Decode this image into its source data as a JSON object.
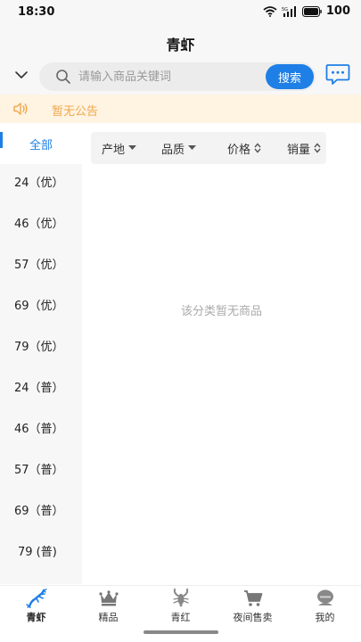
{
  "status": {
    "time": "18:30",
    "battery": "100",
    "network": "5G"
  },
  "nav": {
    "title": "青虾"
  },
  "search": {
    "placeholder": "请输入商品关键词",
    "button_label": "搜索"
  },
  "notice": {
    "text": "暂无公告"
  },
  "sidebar": {
    "items": [
      {
        "label": "全部",
        "active": true
      },
      {
        "label": "24（优）"
      },
      {
        "label": "46（优）"
      },
      {
        "label": "57（优）"
      },
      {
        "label": "69（优）"
      },
      {
        "label": "79（优）"
      },
      {
        "label": "24（普）"
      },
      {
        "label": "46（普）"
      },
      {
        "label": "57（普）"
      },
      {
        "label": "69（普）"
      },
      {
        "label": "79 (普)"
      }
    ]
  },
  "filters": [
    {
      "label": "产地",
      "icon": "caret-down-icon"
    },
    {
      "label": "品质",
      "icon": "caret-down-icon"
    },
    {
      "label": "价格",
      "icon": "sort-icon"
    },
    {
      "label": "销量",
      "icon": "sort-icon"
    }
  ],
  "empty_text": "该分类暂无商品",
  "tabbar": {
    "items": [
      {
        "label": "青虾",
        "icon": "lobster-icon",
        "active": true
      },
      {
        "label": "精品",
        "icon": "crown-icon"
      },
      {
        "label": "青红",
        "icon": "crayfish-icon"
      },
      {
        "label": "夜间售卖",
        "icon": "cart-icon"
      },
      {
        "label": "我的",
        "icon": "user-icon"
      }
    ]
  },
  "colors": {
    "accent": "#1e7fe6",
    "notice_bg": "#fff3e2",
    "notice_text": "#f0a84a",
    "muted": "#aaaaaa"
  }
}
